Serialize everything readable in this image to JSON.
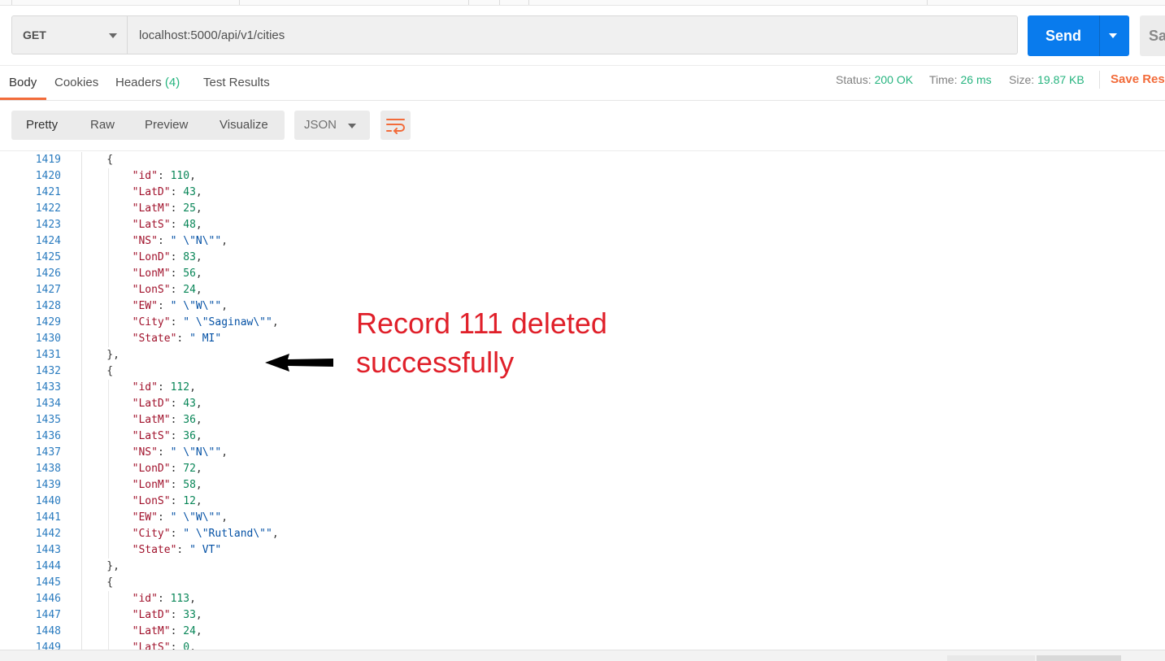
{
  "request": {
    "method": "GET",
    "url": "localhost:5000/api/v1/cities",
    "send_label": "Send",
    "save_label": "Sa"
  },
  "response_tabs": {
    "body": "Body",
    "cookies": "Cookies",
    "headers": "Headers",
    "headers_count": "(4)",
    "test_results": "Test Results"
  },
  "status": {
    "status_label": "Status:",
    "status_value": "200 OK",
    "time_label": "Time:",
    "time_value": "26 ms",
    "size_label": "Size:",
    "size_value": "19.87 KB",
    "save_response": "Save Resp"
  },
  "view_modes": {
    "pretty": "Pretty",
    "raw": "Raw",
    "preview": "Preview",
    "visualize": "Visualize",
    "format": "JSON"
  },
  "annotation": {
    "line1": "Record 111 deleted",
    "line2": "successfully"
  },
  "code_lines": [
    {
      "n": "1419",
      "t": "    {"
    },
    {
      "n": "1420",
      "t": "        \"id\": 110,"
    },
    {
      "n": "1421",
      "t": "        \"LatD\": 43,"
    },
    {
      "n": "1422",
      "t": "        \"LatM\": 25,"
    },
    {
      "n": "1423",
      "t": "        \"LatS\": 48,"
    },
    {
      "n": "1424",
      "t": "        \"NS\": \" \\\"N\\\"\","
    },
    {
      "n": "1425",
      "t": "        \"LonD\": 83,"
    },
    {
      "n": "1426",
      "t": "        \"LonM\": 56,"
    },
    {
      "n": "1427",
      "t": "        \"LonS\": 24,"
    },
    {
      "n": "1428",
      "t": "        \"EW\": \" \\\"W\\\"\","
    },
    {
      "n": "1429",
      "t": "        \"City\": \" \\\"Saginaw\\\"\","
    },
    {
      "n": "1430",
      "t": "        \"State\": \" MI\""
    },
    {
      "n": "1431",
      "t": "    },"
    },
    {
      "n": "1432",
      "t": "    {"
    },
    {
      "n": "1433",
      "t": "        \"id\": 112,"
    },
    {
      "n": "1434",
      "t": "        \"LatD\": 43,"
    },
    {
      "n": "1435",
      "t": "        \"LatM\": 36,"
    },
    {
      "n": "1436",
      "t": "        \"LatS\": 36,"
    },
    {
      "n": "1437",
      "t": "        \"NS\": \" \\\"N\\\"\","
    },
    {
      "n": "1438",
      "t": "        \"LonD\": 72,"
    },
    {
      "n": "1439",
      "t": "        \"LonM\": 58,"
    },
    {
      "n": "1440",
      "t": "        \"LonS\": 12,"
    },
    {
      "n": "1441",
      "t": "        \"EW\": \" \\\"W\\\"\","
    },
    {
      "n": "1442",
      "t": "        \"City\": \" \\\"Rutland\\\"\","
    },
    {
      "n": "1443",
      "t": "        \"State\": \" VT\""
    },
    {
      "n": "1444",
      "t": "    },"
    },
    {
      "n": "1445",
      "t": "    {"
    },
    {
      "n": "1446",
      "t": "        \"id\": 113,"
    },
    {
      "n": "1447",
      "t": "        \"LatD\": 33,"
    },
    {
      "n": "1448",
      "t": "        \"LatM\": 24,"
    },
    {
      "n": "1449",
      "t": "        \"LatS\": 0,"
    }
  ]
}
